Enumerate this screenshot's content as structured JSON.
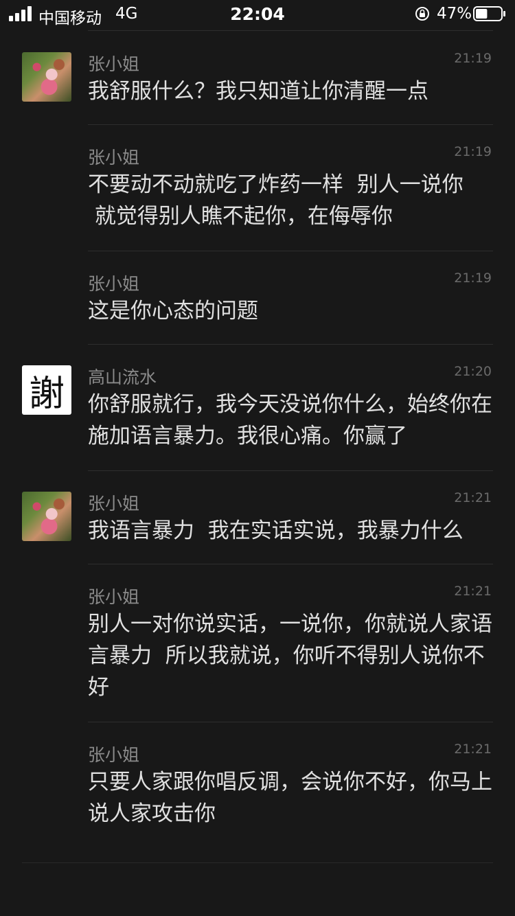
{
  "status_bar": {
    "carrier": "中国移动",
    "network": "4G",
    "time": "22:04",
    "battery_percent": "47%",
    "battery_level": 0.47
  },
  "messages": [
    {
      "sender": "张小姐",
      "time": "21:19",
      "avatar": "photo-avatar",
      "text": "我舒服什么？我只知道让你清醒一点"
    },
    {
      "sender": "张小姐",
      "time": "21:19",
      "avatar": null,
      "text": "不要动不动就吃了炸药一样  别人一说你\n 就觉得别人瞧不起你，在侮辱你"
    },
    {
      "sender": "张小姐",
      "time": "21:19",
      "avatar": null,
      "text": "这是你心态的问题"
    },
    {
      "sender": "高山流水",
      "time": "21:20",
      "avatar": "calligraphy-avatar",
      "avatar_char": "謝",
      "text": "你舒服就行，我今天没说你什么，始终你在施加语言暴力。我很心痛。你赢了"
    },
    {
      "sender": "张小姐",
      "time": "21:21",
      "avatar": "photo-avatar",
      "text": "我语言暴力  我在实话实说，我暴力什么"
    },
    {
      "sender": "张小姐",
      "time": "21:21",
      "avatar": null,
      "text": "别人一对你说实话，一说你，你就说人家语言暴力  所以我就说，你听不得别人说你不好"
    },
    {
      "sender": "张小姐",
      "time": "21:21",
      "avatar": null,
      "text": "只要人家跟你唱反调，会说你不好，你马上说人家攻击你"
    }
  ]
}
